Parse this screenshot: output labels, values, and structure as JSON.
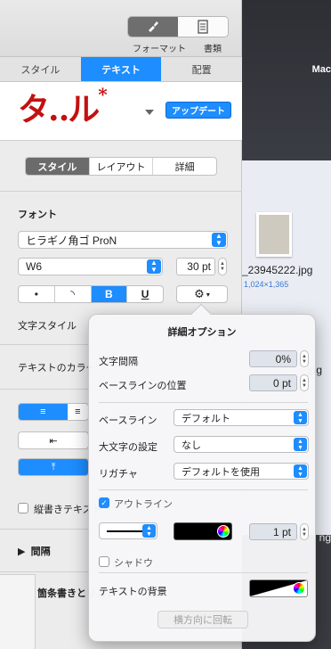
{
  "toolbar": {
    "format_label": "フォーマット",
    "document_label": "書類",
    "format_icon": "paintbrush-icon",
    "document_icon": "document-icon"
  },
  "tabs": [
    {
      "label": "スタイル"
    },
    {
      "label": "テキスト",
      "active": true
    },
    {
      "label": "配置"
    }
  ],
  "paragraph_style": {
    "sample": "タ‥ル",
    "asterisk": "*",
    "update_button": "アップデート"
  },
  "subtabs": [
    {
      "label": "スタイル",
      "active": true
    },
    {
      "label": "レイアウト"
    },
    {
      "label": "詳細"
    }
  ],
  "font": {
    "section_label": "フォント",
    "family": "ヒラギノ角ゴ ProN",
    "weight": "W6",
    "size": "30 pt",
    "format_buttons": [
      "•",
      "◝",
      "B",
      "U"
    ],
    "char_style_label": "文字スタイル",
    "text_color_label": "テキストのカラー"
  },
  "vertical_text_label": "縦書きテキスト",
  "spacing_label": "間隔",
  "bullets_label": "箇条書きとリスト",
  "popover": {
    "title": "詳細オプション",
    "char_spacing_label": "文字間隔",
    "char_spacing_value": "0%",
    "baseline_pos_label": "ベースラインの位置",
    "baseline_pos_value": "0 pt",
    "baseline_label": "ベースライン",
    "baseline_value": "デフォルト",
    "caps_label": "大文字の設定",
    "caps_value": "なし",
    "ligature_label": "リガチャ",
    "ligature_value": "デフォルトを使用",
    "outline_label": "アウトライン",
    "outline_checked": true,
    "outline_width": "1 pt",
    "outline_color": "#000000",
    "shadow_label": "シャドウ",
    "shadow_checked": false,
    "bg_label": "テキストの背景",
    "rotate_button": "横方向に回転"
  },
  "desktop": {
    "label": "Mac",
    "file1": "_23945222.jpg",
    "file1_sub": "1,024×1,365",
    "file2": "jpg",
    "file3": "ng"
  },
  "colors": {
    "accent": "#1d8dff",
    "title_red": "#c41010"
  }
}
